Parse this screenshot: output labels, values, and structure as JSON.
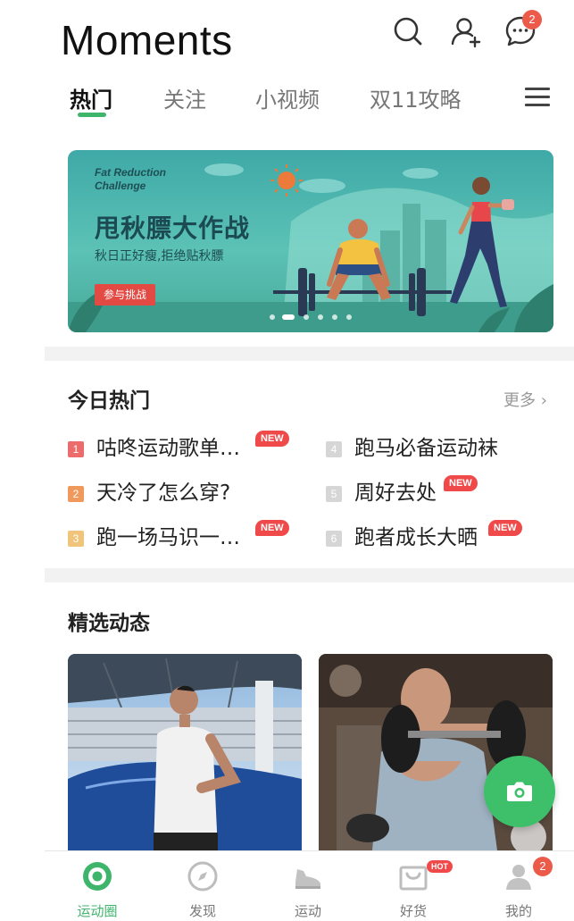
{
  "header": {
    "title": "Moments",
    "messages_badge": "2"
  },
  "tabs": [
    {
      "label": "热门",
      "active": true
    },
    {
      "label": "关注",
      "active": false
    },
    {
      "label": "小视频",
      "active": false
    },
    {
      "label": "双11攻略",
      "active": false
    }
  ],
  "banner": {
    "subtitle_en": "Fat Reduction Challenge",
    "title": "甩秋膘大作战",
    "description": "秋日正好瘦,拒绝贴秋膘",
    "cta_label": "参与挑战",
    "slide_count": 6,
    "active_slide": 2
  },
  "hot_today": {
    "title": "今日热门",
    "more_label": "更多 ›",
    "items": [
      {
        "rank": "1",
        "text": "咕咚运动歌单…",
        "new": true,
        "rank_color": "#ec6b6b"
      },
      {
        "rank": "2",
        "text": "天冷了怎么穿?",
        "new": false,
        "rank_color": "#f0995c"
      },
      {
        "rank": "3",
        "text": "跑一场马识一…",
        "new": true,
        "rank_color": "#f0c47a"
      },
      {
        "rank": "4",
        "text": "跑马必备运动袜",
        "new": false,
        "rank_color": "#d6d6d6"
      },
      {
        "rank": "5",
        "text": "周好去处",
        "new": true,
        "rank_color": "#d6d6d6"
      },
      {
        "rank": "6",
        "text": "跑者成长大晒",
        "new": true,
        "rank_color": "#d6d6d6"
      }
    ],
    "new_label": "NEW"
  },
  "featured": {
    "title": "精选动态"
  },
  "bottom_nav": {
    "items": [
      {
        "label": "运动圈",
        "icon": "sport-circle-icon",
        "active": true
      },
      {
        "label": "发现",
        "icon": "compass-icon",
        "active": false
      },
      {
        "label": "运动",
        "icon": "sneaker-icon",
        "active": false
      },
      {
        "label": "好货",
        "icon": "shop-icon",
        "active": false
      },
      {
        "label": "我的",
        "icon": "profile-icon",
        "active": false
      }
    ],
    "hot_label": "HOT",
    "profile_badge": "2"
  },
  "colors": {
    "accent_green": "#3fb56b",
    "badge_red": "#ec5a4a"
  }
}
